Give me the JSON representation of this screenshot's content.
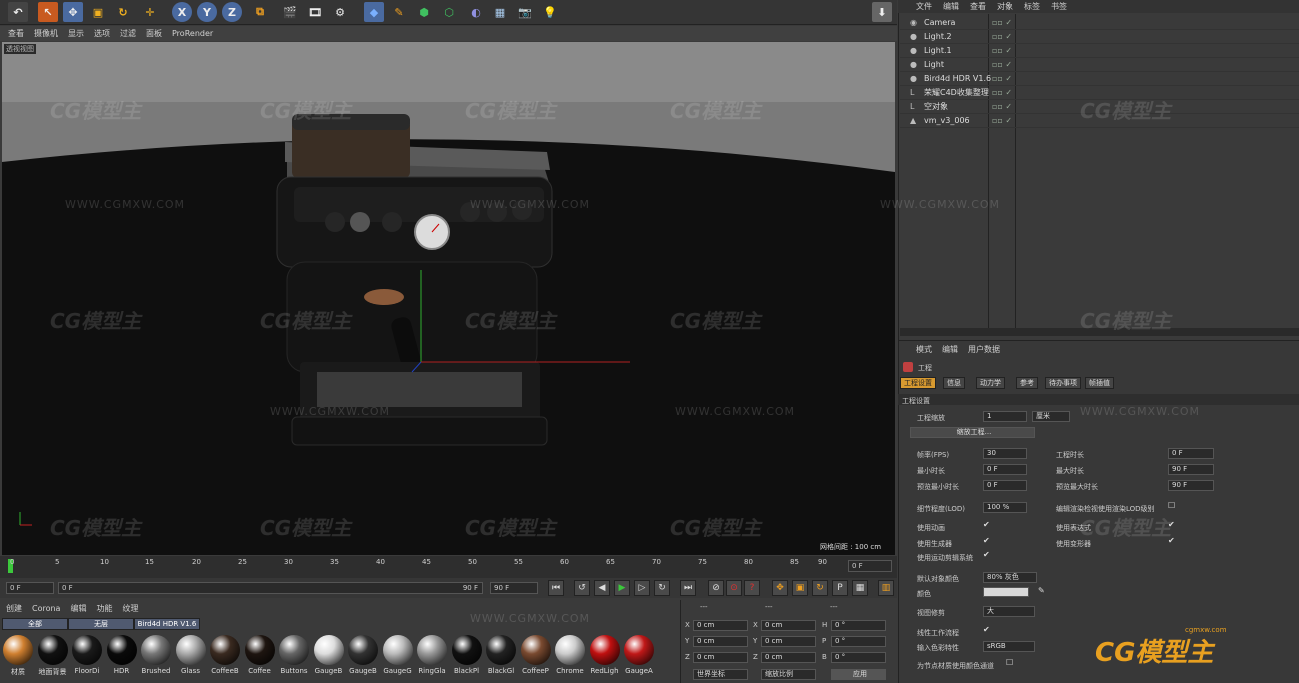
{
  "toolbar": {
    "icons": [
      "undo-icon",
      "pointer-icon",
      "move-icon",
      "scale-icon",
      "rotate-icon",
      "transform-icon",
      "x-axis-icon",
      "y-axis-icon",
      "z-axis-icon",
      "coordinate-icon",
      "render-view-icon",
      "render-picture-icon",
      "render-settings-icon",
      "cube-icon",
      "pen-icon",
      "subdivision-icon",
      "array-icon",
      "deformer-icon",
      "floor-icon",
      "camera-icon",
      "light-icon"
    ],
    "x_label": "X",
    "y_label": "Y",
    "z_label": "Z",
    "export_label": "⬇"
  },
  "viewport": {
    "menu": [
      "查看",
      "摄像机",
      "显示",
      "选项",
      "过滤",
      "面板",
      "ProRender"
    ],
    "title": "透视视图",
    "grid_info": "网格间距 : 100 cm"
  },
  "timeline": {
    "ticks": [
      "0",
      "5",
      "10",
      "15",
      "20",
      "25",
      "30",
      "35",
      "40",
      "45",
      "50",
      "55",
      "60",
      "65",
      "70",
      "75",
      "80",
      "85",
      "90"
    ],
    "current_frame_right": "0 F",
    "start": "0 F",
    "range_start": "0 F",
    "range_end": "90 F",
    "end": "90 F"
  },
  "transport": {
    "buttons": [
      "⏮",
      "↺",
      "◀",
      "▶",
      "▷",
      "↻",
      "⏭"
    ]
  },
  "materials": {
    "menu": [
      "创建",
      "Corona",
      "编辑",
      "功能",
      "纹理"
    ],
    "tabs": [
      "全部",
      "无层",
      "Bird4d HDR V1.6"
    ],
    "items": [
      {
        "name": "材质",
        "color": "#d08030"
      },
      {
        "name": "地面背景",
        "color": "#111111"
      },
      {
        "name": "FloorDi",
        "color": "#1a1a1a"
      },
      {
        "name": "HDR",
        "color": "#0a0a0a"
      },
      {
        "name": "Brushed",
        "color": "#777777"
      },
      {
        "name": "Glass",
        "color": "#aaaaaa"
      },
      {
        "name": "CoffeeB",
        "color": "#3a2a20"
      },
      {
        "name": "Coffee",
        "color": "#1e1510"
      },
      {
        "name": "Buttons",
        "color": "#666666"
      },
      {
        "name": "GaugeB",
        "color": "#dddddd"
      },
      {
        "name": "GaugeB",
        "color": "#333333"
      },
      {
        "name": "GaugeG",
        "color": "#bbbbbb"
      },
      {
        "name": "RingGla",
        "color": "#999999"
      },
      {
        "name": "BlackPl",
        "color": "#111111"
      },
      {
        "name": "BlackGl",
        "color": "#222222"
      },
      {
        "name": "CoffeeP",
        "color": "#7a4a30"
      },
      {
        "name": "Chrome",
        "color": "#cccccc"
      },
      {
        "name": "RedLigh",
        "color": "#c01010"
      },
      {
        "name": "GaugeA",
        "color": "#c01818"
      }
    ]
  },
  "coords": {
    "headers": [
      "---",
      "---",
      "---"
    ],
    "rows": [
      {
        "a": "X",
        "av": "0 cm",
        "b": "X",
        "bv": "0 cm",
        "c": "H",
        "cv": "0 °"
      },
      {
        "a": "Y",
        "av": "0 cm",
        "b": "Y",
        "bv": "0 cm",
        "c": "P",
        "cv": "0 °"
      },
      {
        "a": "Z",
        "av": "0 cm",
        "b": "Z",
        "bv": "0 cm",
        "c": "B",
        "cv": "0 °"
      }
    ],
    "mode1": "世界坐标",
    "mode2": "缩放比例",
    "apply": "应用"
  },
  "objects": {
    "menu": [
      "文件",
      "编辑",
      "查看",
      "对象",
      "标签",
      "书签"
    ],
    "items": [
      {
        "name": "Camera",
        "icon": "camera-icon"
      },
      {
        "name": "Light.2",
        "icon": "light-icon"
      },
      {
        "name": "Light.1",
        "icon": "light-icon"
      },
      {
        "name": "Light",
        "icon": "light-icon"
      },
      {
        "name": "Bird4d HDR V1.6",
        "icon": "sphere-icon"
      },
      {
        "name": "荣耀C4D收集整理",
        "icon": "null-icon"
      },
      {
        "name": "空对象",
        "icon": "null-icon"
      },
      {
        "name": "vm_v3_006",
        "icon": "polygon-icon"
      }
    ]
  },
  "attributes": {
    "menu": [
      "模式",
      "编辑",
      "用户数据"
    ],
    "project_label": "工程",
    "tabs": [
      "工程设置",
      "信息",
      "动力学",
      "参考",
      "待办事项",
      "帧插值"
    ],
    "section": "工程设置",
    "scale_label": "工程缩放",
    "scale_value": "1",
    "scale_unit": "厘米",
    "scale_button": "缩放工程...",
    "fps_label": "帧率(FPS)",
    "fps_value": "30",
    "min_time_label": "最小时长",
    "min_time_value": "0 F",
    "preview_min_label": "预览最小时长",
    "preview_min_value": "0 F",
    "lod_label": "细节程度(LOD)",
    "lod_value": "100 %",
    "project_time_label": "工程时长",
    "project_time_value": "0 F",
    "max_time_label": "最大时长",
    "max_time_value": "90 F",
    "preview_max_label": "预览最大时长",
    "preview_max_value": "90 F",
    "render_lod_label": "编辑渲染检视使用渲染LOD级别",
    "use_anim_label": "使用动画",
    "use_expr_label": "使用表达式",
    "use_gen_label": "使用生成器",
    "use_deform_label": "使用变形器",
    "use_motion_label": "使用运动剪辑系统",
    "default_color_label": "默认对象颜色",
    "default_color_value": "80% 灰色",
    "color_label": "颜色",
    "color_swatch": "#d8d8d8",
    "view_clip_label": "视图修剪",
    "view_clip_value": "大",
    "linear_label": "线性工作流程",
    "input_color_label": "输入色彩特性",
    "input_color_value": "sRGB",
    "node_color_label": "为节点材质使用颜色通道"
  },
  "watermarks": {
    "logo": "CG模型主",
    "url": "WWW.CGMXW.COM",
    "corner_url": "cgmxw.com"
  }
}
